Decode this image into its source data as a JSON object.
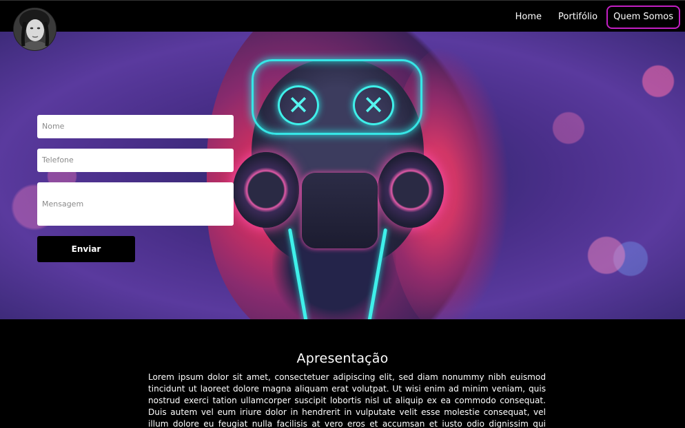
{
  "nav": {
    "items": [
      {
        "label": "Home"
      },
      {
        "label": "Portifólio"
      },
      {
        "label": "Quem Somos"
      }
    ]
  },
  "colors": {
    "nav_active_border": "#c41fc4",
    "background": "#000000",
    "neon_cyan": "#36e6e6",
    "neon_pink": "#ff4fb0"
  },
  "form": {
    "name_placeholder": "Nome",
    "phone_placeholder": "Telefone",
    "message_placeholder": "Mensagem",
    "submit_label": "Enviar"
  },
  "about": {
    "title": "Apresentação",
    "body": "Lorem ipsum dolor sit amet, consectetuer adipiscing elit, sed diam nonummy nibh euismod tincidunt ut laoreet dolore magna aliquam erat volutpat. Ut wisi enim ad minim veniam, quis nostrud exerci tation ullamcorper suscipit lobortis nisl ut aliquip ex ea commodo consequat. Duis autem vel eum iriure dolor in hendrerit in vulputate velit esse molestie consequat, vel illum dolore eu feugiat nulla facilisis at vero eros et accumsan et iusto odio dignissim qui blandit praesent luptatum zzril delenit augue duis dolore te feugait nulla facilisi."
  }
}
